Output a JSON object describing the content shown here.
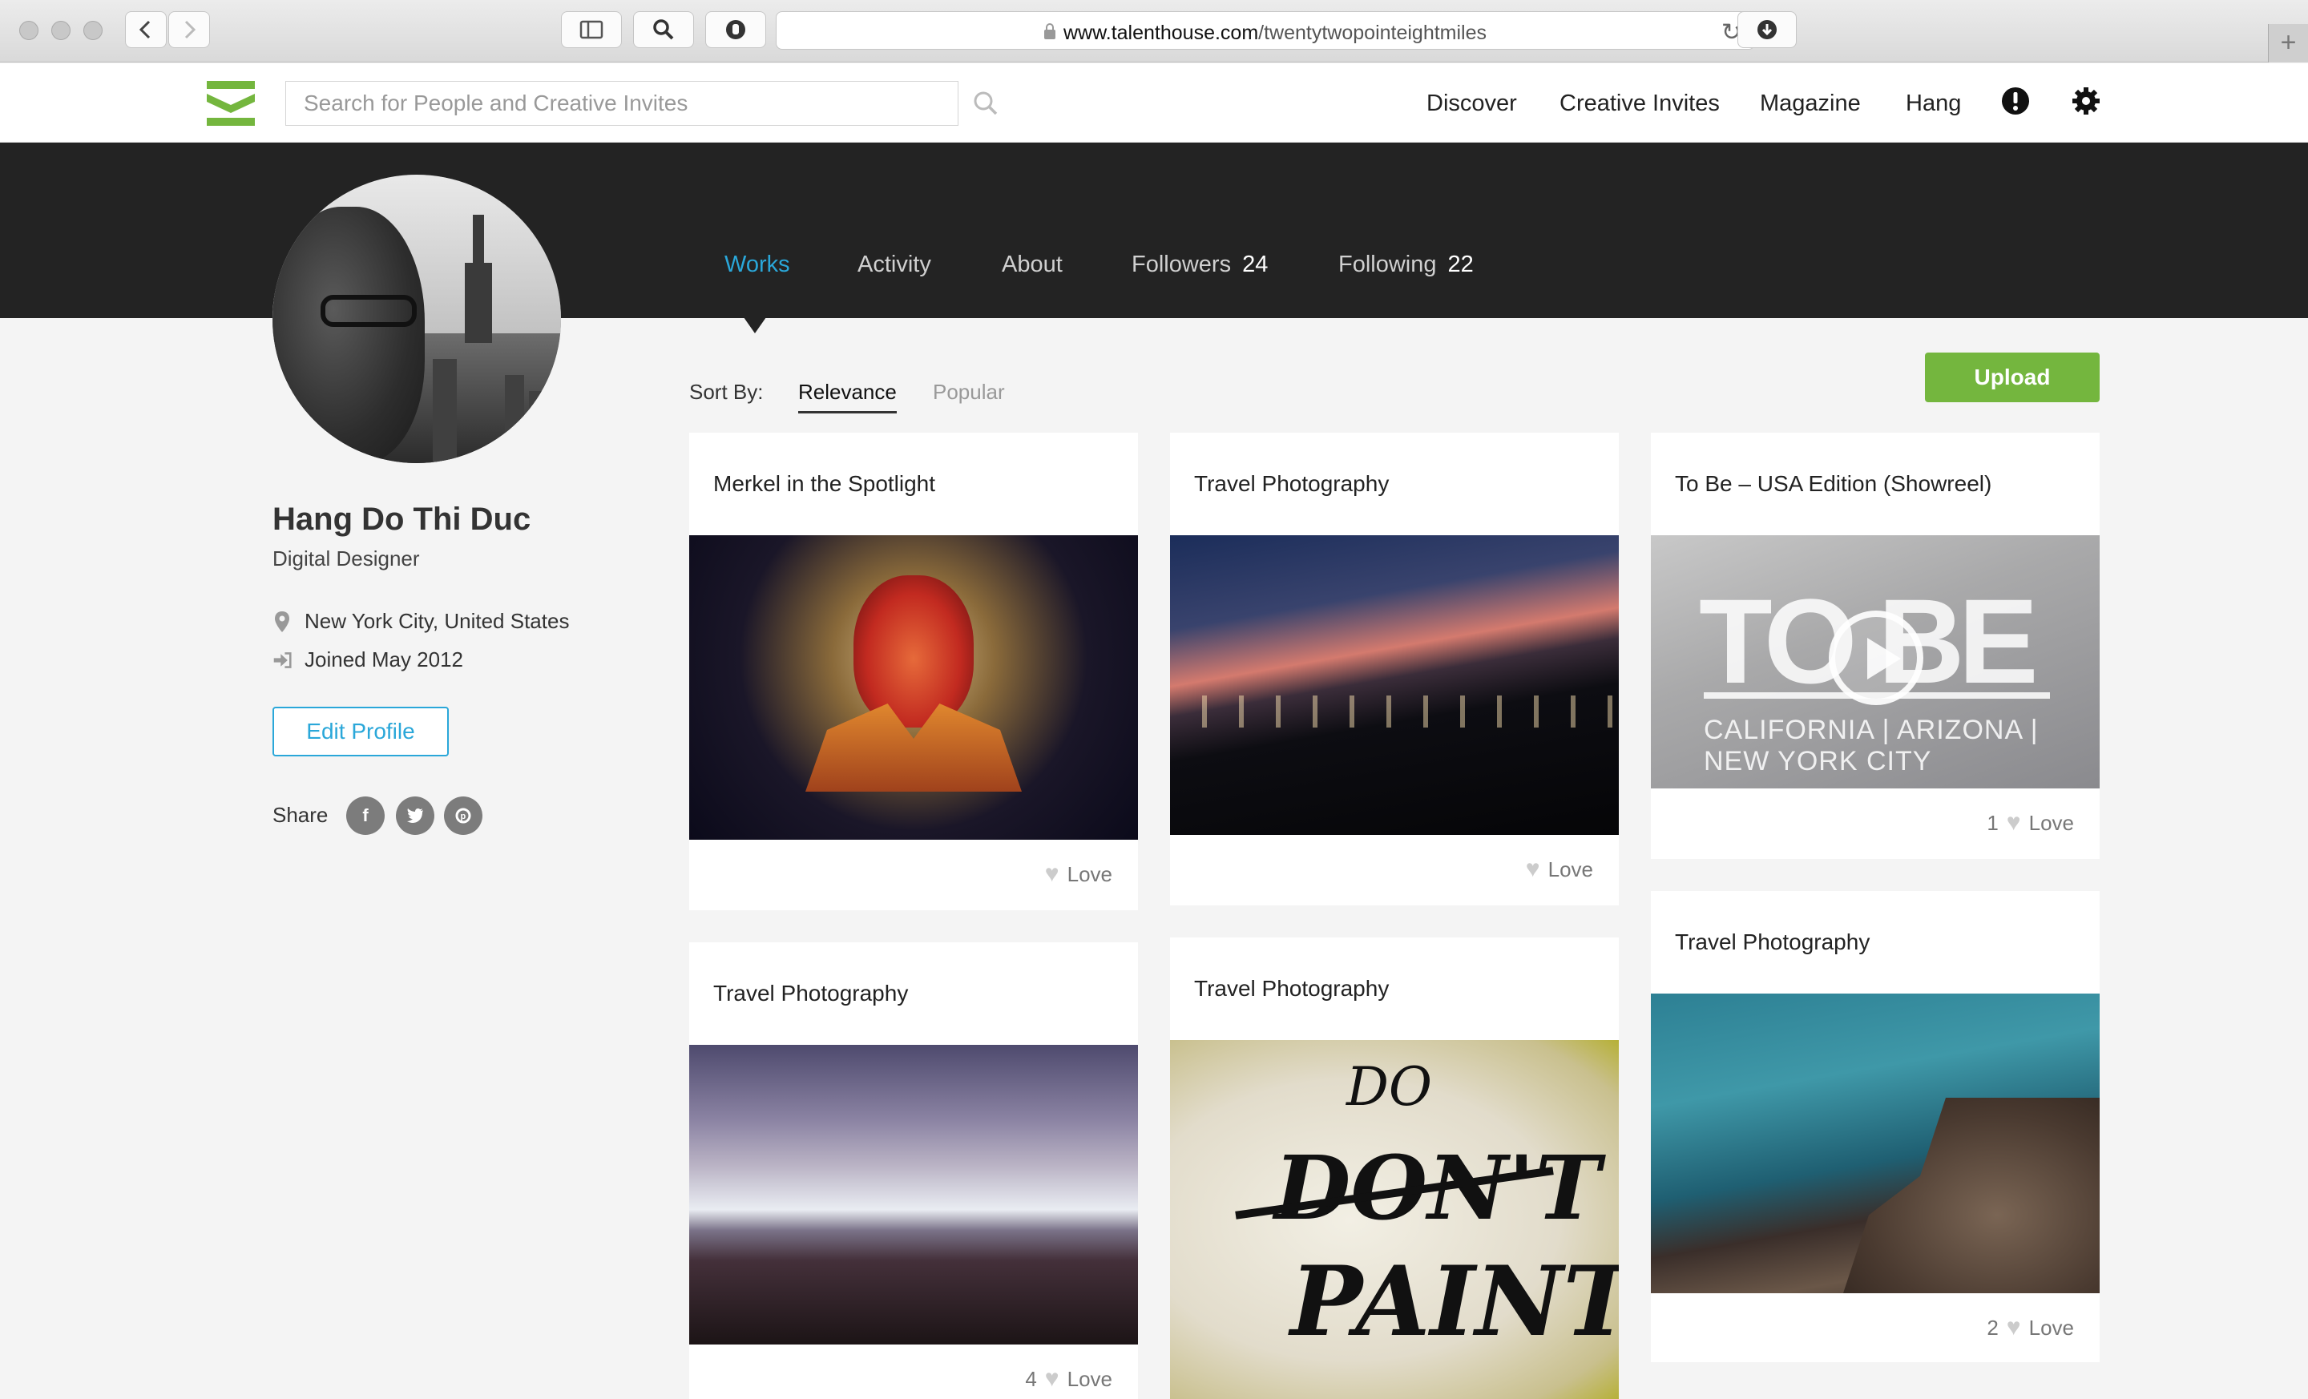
{
  "browser": {
    "url_domain": "www.talenthouse.com",
    "url_path": "/twentytwopointeightmiles"
  },
  "header": {
    "search_placeholder": "Search for People and Creative Invites",
    "nav": {
      "discover": "Discover",
      "creative_invites": "Creative Invites",
      "magazine": "Magazine",
      "hang": "Hang"
    }
  },
  "profile_tabs": {
    "works": "Works",
    "activity": "Activity",
    "about": "About",
    "followers_label": "Followers",
    "followers_count": "24",
    "following_label": "Following",
    "following_count": "22"
  },
  "profile": {
    "name": "Hang Do Thi Duc",
    "title": "Digital Designer",
    "location": "New York City, United States",
    "joined": "Joined May 2012",
    "edit_label": "Edit Profile",
    "share_label": "Share"
  },
  "sort": {
    "label": "Sort By:",
    "relevance": "Relevance",
    "popular": "Popular"
  },
  "upload_label": "Upload",
  "cards": [
    {
      "title": "Merkel in the Spotlight",
      "love_label": "Love",
      "love_count": ""
    },
    {
      "title": "Travel Photography",
      "love_label": "Love",
      "love_count": ""
    },
    {
      "title": "To Be – USA Edition (Showreel)",
      "love_label": "Love",
      "love_count": "1",
      "image_title": "TO BE",
      "image_subtitle": "CALIFORNIA | ARIZONA | NEW YORK CITY"
    },
    {
      "title": "Travel Photography",
      "love_label": "Love",
      "love_count": "4"
    },
    {
      "title": "Travel Photography",
      "image_text_1": "DO",
      "image_text_2": "DON'T",
      "image_text_3": "PAINT"
    },
    {
      "title": "Travel Photography",
      "love_label": "Love",
      "love_count": "2"
    }
  ],
  "colors": {
    "accent_blue": "#2aa7d9",
    "upload_green": "#74b63e",
    "band_dark": "#232323",
    "logo_green": "#74b63e"
  },
  "icons": {
    "location": "map-pin-icon",
    "joined": "sign-in-icon",
    "heart": "heart-icon",
    "share": [
      "facebook-icon",
      "twitter-icon",
      "pinterest-icon"
    ]
  }
}
